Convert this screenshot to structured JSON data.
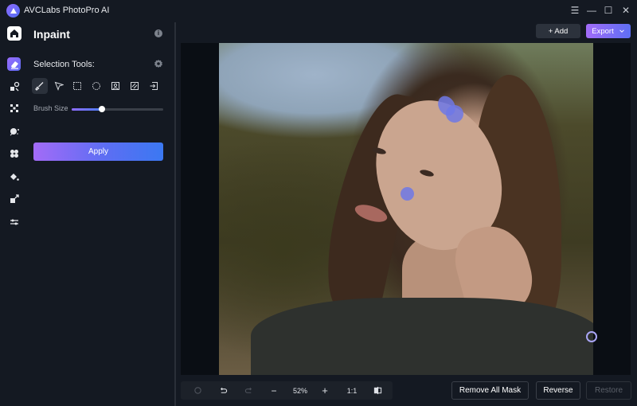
{
  "app": {
    "title": "AVCLabs PhotoPro AI",
    "window_controls": [
      "menu-icon",
      "minimize-icon",
      "maximize-icon",
      "close-icon"
    ]
  },
  "rail": {
    "items": [
      {
        "icon": "home-icon",
        "active": false
      },
      {
        "icon": "inpaint-eraser-icon",
        "active": true
      },
      {
        "icon": "object-select-icon",
        "active": false
      },
      {
        "icon": "background-icon",
        "active": false
      },
      {
        "icon": "enhance-icon",
        "active": false
      },
      {
        "icon": "cutout-icon",
        "active": false
      },
      {
        "icon": "colorize-icon",
        "active": false
      },
      {
        "icon": "upscale-icon",
        "active": false
      },
      {
        "icon": "adjust-icon",
        "active": false
      }
    ]
  },
  "panel": {
    "title": "Inpaint",
    "selection_tools_label": "Selection Tools:",
    "tools": [
      {
        "name": "brush",
        "icon": "brush-icon",
        "active": true
      },
      {
        "name": "lasso",
        "icon": "pointer-lasso-icon",
        "active": false
      },
      {
        "name": "rectangle",
        "icon": "rectangle-select-icon",
        "active": false
      },
      {
        "name": "ellipse",
        "icon": "ellipse-select-icon",
        "active": false
      },
      {
        "name": "portrait",
        "icon": "portrait-select-icon",
        "active": false
      },
      {
        "name": "pattern",
        "icon": "pattern-select-icon",
        "active": false
      },
      {
        "name": "import",
        "icon": "import-icon",
        "active": false
      }
    ],
    "brush_size_label": "Brush Size",
    "brush_size_fraction": 0.33,
    "apply_label": "Apply"
  },
  "topbar": {
    "add_label": "+ Add",
    "export_label": "Export"
  },
  "bottom": {
    "zoom_level": "52%",
    "zoom_minus": "−",
    "zoom_plus": "+",
    "actual_size": "1:1",
    "remove_all_mask": "Remove All Mask",
    "reverse": "Reverse",
    "restore": "Restore"
  },
  "colors": {
    "accent_start": "#a36bf7",
    "accent_end": "#3b78f2",
    "mask": "#6e78e6",
    "background": "#141922",
    "canvas": "#0a0e14"
  }
}
